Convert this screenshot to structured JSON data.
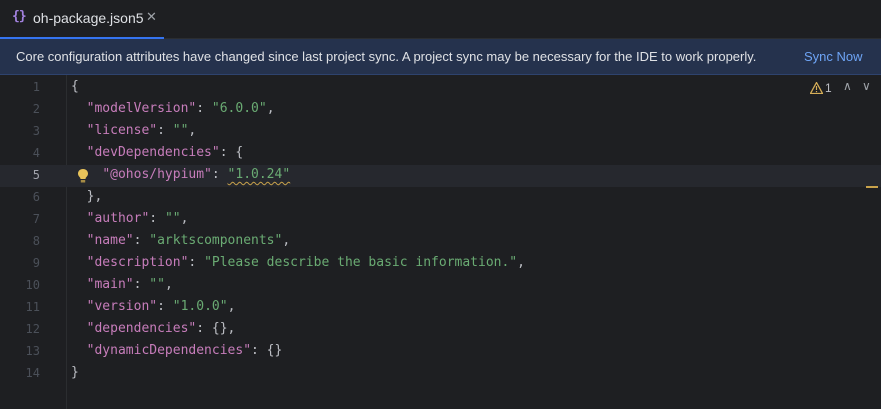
{
  "tab": {
    "icon": "{}",
    "label": "oh-package.json5",
    "close": "✕"
  },
  "banner": {
    "message": "Core configuration attributes have changed since last project sync. A project sync may be necessary for the IDE to work properly.",
    "action": "Sync Now"
  },
  "inspection": {
    "warning_count": "1",
    "up": "∧",
    "down": "∨"
  },
  "colors": {
    "background": "#1e1f22",
    "banner": "#25324d",
    "key": "#c77dbb",
    "string": "#6aab73",
    "accent": "#3574f0"
  },
  "editor": {
    "current_line": 5,
    "lines": [
      {
        "n": "1",
        "indent": "",
        "key": "",
        "sep": "",
        "value": "",
        "tail": "{"
      },
      {
        "n": "2",
        "indent": "  ",
        "key": "\"modelVersion\"",
        "sep": ": ",
        "value": "\"6.0.0\"",
        "tail": ","
      },
      {
        "n": "3",
        "indent": "  ",
        "key": "\"license\"",
        "sep": ": ",
        "value": "\"\"",
        "tail": ","
      },
      {
        "n": "4",
        "indent": "  ",
        "key": "\"devDependencies\"",
        "sep": ": {",
        "value": "",
        "tail": ""
      },
      {
        "n": "5",
        "indent": "    ",
        "key": "\"@ohos/hypium\"",
        "sep": ": ",
        "value": "\"1.0.24\"",
        "tail": ""
      },
      {
        "n": "6",
        "indent": "  ",
        "key": "",
        "sep": "",
        "value": "",
        "tail": "},"
      },
      {
        "n": "7",
        "indent": "  ",
        "key": "\"author\"",
        "sep": ": ",
        "value": "\"\"",
        "tail": ","
      },
      {
        "n": "8",
        "indent": "  ",
        "key": "\"name\"",
        "sep": ": ",
        "value": "\"arktscomponents\"",
        "tail": ","
      },
      {
        "n": "9",
        "indent": "  ",
        "key": "\"description\"",
        "sep": ": ",
        "value": "\"Please describe the basic information.\"",
        "tail": ","
      },
      {
        "n": "10",
        "indent": "  ",
        "key": "\"main\"",
        "sep": ": ",
        "value": "\"\"",
        "tail": ","
      },
      {
        "n": "11",
        "indent": "  ",
        "key": "\"version\"",
        "sep": ": ",
        "value": "\"1.0.0\"",
        "tail": ","
      },
      {
        "n": "12",
        "indent": "  ",
        "key": "\"dependencies\"",
        "sep": ": {}",
        "value": "",
        "tail": ","
      },
      {
        "n": "13",
        "indent": "  ",
        "key": "\"dynamicDependencies\"",
        "sep": ": {}",
        "value": "",
        "tail": ""
      },
      {
        "n": "14",
        "indent": "",
        "key": "",
        "sep": "",
        "value": "",
        "tail": "}"
      }
    ]
  }
}
